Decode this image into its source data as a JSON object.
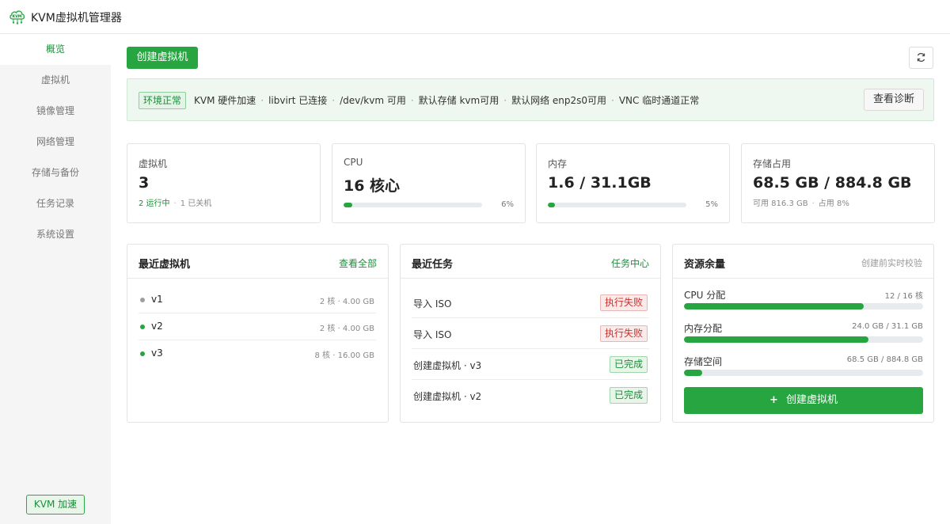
{
  "app": {
    "title": "KVM虚拟机管理器",
    "logo_text": "KVM"
  },
  "sidebar": {
    "items": [
      {
        "label": "概览",
        "active": true
      },
      {
        "label": "虚拟机",
        "active": false
      },
      {
        "label": "镜像管理",
        "active": false
      },
      {
        "label": "网络管理",
        "active": false
      },
      {
        "label": "存储与备份",
        "active": false
      },
      {
        "label": "任务记录",
        "active": false
      },
      {
        "label": "系统设置",
        "active": false
      }
    ],
    "badge": "KVM 加速"
  },
  "toolbar": {
    "create_label": "创建虚拟机",
    "refresh_icon": "refresh-icon"
  },
  "env": {
    "tag": "环境正常",
    "items": [
      "KVM 硬件加速",
      "libvirt 已连接",
      "/dev/kvm 可用",
      "默认存储 kvm可用",
      "默认网络 enp2s0可用",
      "VNC 临时通道正常"
    ],
    "separator": "·",
    "diagnose_label": "查看诊断"
  },
  "stats": {
    "vm": {
      "label": "虚拟机",
      "value": "3",
      "running": "2 运行中",
      "stopped": "1 已关机"
    },
    "cpu": {
      "label": "CPU",
      "value": "16 核心",
      "percent": 6,
      "percent_label": "6%"
    },
    "memory": {
      "label": "内存",
      "value": "1.6 / 31.1GB",
      "percent": 5,
      "percent_label": "5%"
    },
    "storage": {
      "label": "存储占用",
      "value": "68.5 GB / 884.8 GB",
      "available": "可用 816.3 GB",
      "used": "占用 8%"
    }
  },
  "recent_vms": {
    "title": "最近虚拟机",
    "link": "查看全部",
    "items": [
      {
        "name": "v1",
        "spec": "2 核 · 4.00 GB",
        "status_color": "#9e9e9e"
      },
      {
        "name": "v2",
        "spec": "2 核 · 4.00 GB",
        "status_color": "#26a541"
      },
      {
        "name": "v3",
        "spec": "8 核 · 16.00 GB",
        "status_color": "#26a541"
      }
    ]
  },
  "recent_tasks": {
    "title": "最近任务",
    "link": "任务中心",
    "items": [
      {
        "name": "导入 ISO",
        "status": "执行失败",
        "kind": "fail"
      },
      {
        "name": "导入 ISO",
        "status": "执行失败",
        "kind": "fail"
      },
      {
        "name": "创建虚拟机 · v3",
        "status": "已完成",
        "kind": "done"
      },
      {
        "name": "创建虚拟机 · v2",
        "status": "已完成",
        "kind": "done"
      }
    ]
  },
  "resources": {
    "title": "资源余量",
    "note": "创建前实时校验",
    "items": [
      {
        "label": "CPU 分配",
        "value": "12 / 16 核",
        "fraction": 0.75
      },
      {
        "label": "内存分配",
        "value": "24.0 GB / 31.1 GB",
        "fraction": 0.772
      },
      {
        "label": "存储空间",
        "value": "68.5 GB / 884.8 GB",
        "fraction": 0.077
      }
    ],
    "create_plus": "+",
    "create_label": "创建虚拟机"
  },
  "colors": {
    "accent": "#26a541",
    "accent_text": "#1b8f3a",
    "fail": "#c9302c",
    "stopped_dot": "#9e9e9e"
  }
}
